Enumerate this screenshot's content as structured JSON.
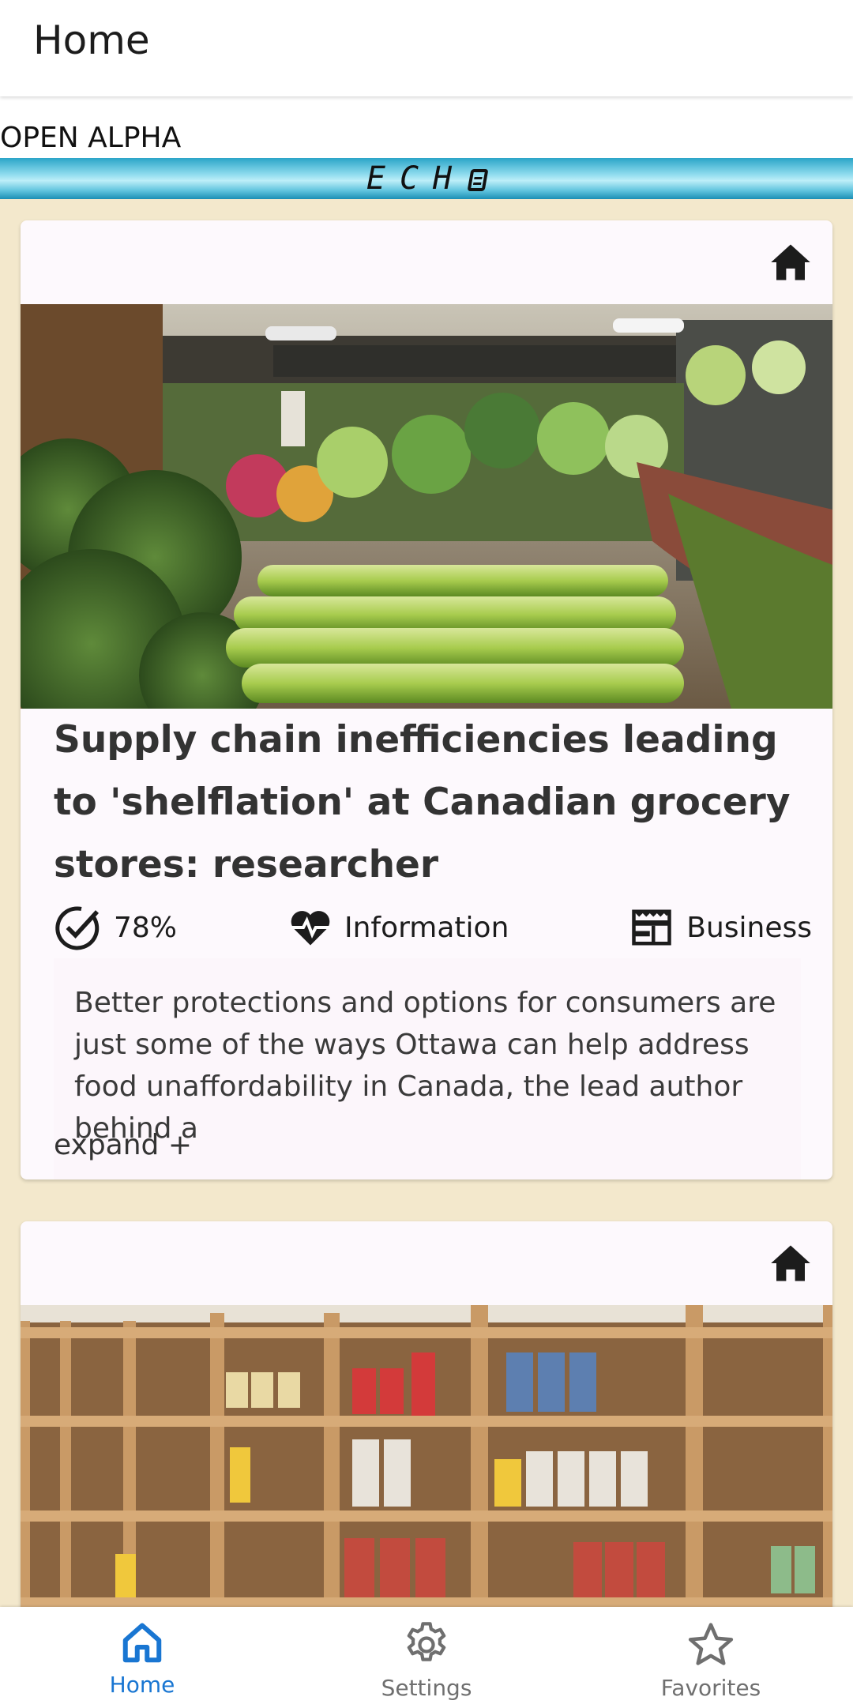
{
  "appbar": {
    "title": "Home"
  },
  "banner": {
    "alpha_text": "OPEN ALPHA",
    "echo_text": "ECH"
  },
  "articles": [
    {
      "title": "Supply chain inefficiencies leading to 'shelflation' at Canadian grocery stores: researcher",
      "credibility": "78%",
      "type": "Information",
      "category": "Business",
      "summary": "Better protections and options for consumers are just some of the ways Ottawa can help address food unaffordability in Canada, the lead author behind a",
      "expand_label": "expand +",
      "image_icon": "home-icon",
      "image_subject": "produce-aisle-photo"
    },
    {
      "image_icon": "home-icon",
      "image_subject": "canned-goods-shelves-photo"
    }
  ],
  "bottom_nav": {
    "items": [
      {
        "label": "Home",
        "icon": "home-outline-icon",
        "active": true
      },
      {
        "label": "Settings",
        "icon": "gear-icon",
        "active": false
      },
      {
        "label": "Favorites",
        "icon": "star-icon",
        "active": false
      }
    ]
  },
  "colors": {
    "accent": "#1976d2",
    "background": "#f3e8cc",
    "card": "#fdf9fd",
    "banner": "#5ec3dd"
  }
}
